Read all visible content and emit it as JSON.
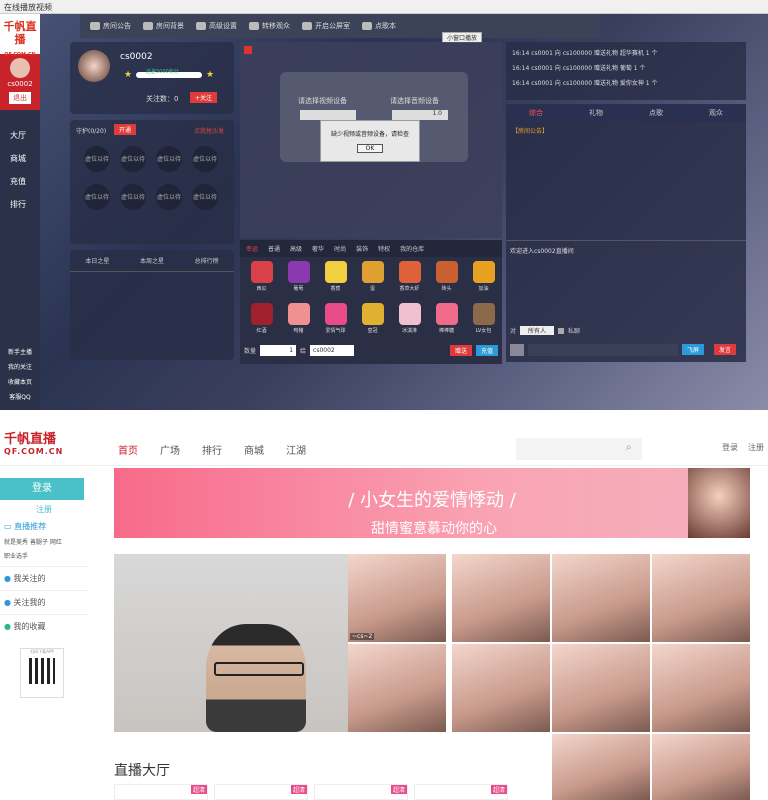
{
  "shot1": {
    "title": "在线播放视频",
    "topbar": [
      "房间公告",
      "房间背景",
      "高级设置",
      "转移观众",
      "开启公屏室",
      "点歌本"
    ],
    "popout": "小窗口播放",
    "logo": "千帆直播",
    "logo_sub": "QF.COM.CN",
    "side_user": "cs0002",
    "exit": "退出",
    "nav": [
      "大厅",
      "商城",
      "充值",
      "排行"
    ],
    "bottom_nav": [
      "新手主播",
      "我的关注",
      "收藏本页",
      "客服QQ"
    ],
    "user": {
      "name": "cs0002",
      "progress": "还差5000积分",
      "fans_label": "关注数：0",
      "follow": "+关注"
    },
    "guard": {
      "title": "守护(0/20)",
      "btn": "开通",
      "link": "点我抢沙发",
      "seat": "虚位以待"
    },
    "rank_tabs": [
      "本日之星",
      "本周之星",
      "总排行榜"
    ],
    "stage": {
      "video_label": "请选择视频设备",
      "audio_label": "请选择音频设备",
      "audio_value": "1.0",
      "dialog": "缺少视频或音频设备，请检查",
      "ok": "OK"
    },
    "gift_tabs": [
      "幸运",
      "普通",
      "高级",
      "奢华",
      "时尚",
      "装饰",
      "特权",
      "我的仓库"
    ],
    "gifts": [
      {
        "name": "西瓜",
        "color": "#d8404a"
      },
      {
        "name": "葡萄",
        "color": "#8a3ab0"
      },
      {
        "name": "香蕉",
        "color": "#f0d040"
      },
      {
        "name": "蛋",
        "color": "#e0a030"
      },
      {
        "name": "香草大虾",
        "color": "#e0603a"
      },
      {
        "name": "砖头",
        "color": "#c86030"
      },
      {
        "name": "加油",
        "color": "#e8a020"
      },
      {
        "name": "红酒",
        "color": "#a02030"
      },
      {
        "name": "吻猪",
        "color": "#f09090"
      },
      {
        "name": "爱情气球",
        "color": "#e84a8a"
      },
      {
        "name": "皇冠",
        "color": "#e0b030"
      },
      {
        "name": "冰淇淋",
        "color": "#f0c0d0"
      },
      {
        "name": "棒棒糖",
        "color": "#f06a8a"
      },
      {
        "name": "LV女包",
        "color": "#8a6a4a"
      }
    ],
    "gift_bottom": {
      "qty_label": "数量",
      "qty": "1",
      "to": "给",
      "target": "cs0002",
      "send": "赠送",
      "recharge": "充值"
    },
    "chat_lines": [
      "16:14 cs0001 向 cs100000 赠送礼物 超华赛机 1 个",
      "16:14 cs0001 向 cs100000 赠送礼物 葡萄 1 个",
      "16:14 cs0001 向 cs100000 赠送礼物 爱你女神 1 个"
    ],
    "right_tabs": [
      "综合",
      "礼物",
      "点歌",
      "观众"
    ],
    "notice": "【房间公告】",
    "welcome": "欢迎进入cs0002直播间",
    "chat_to": "对",
    "chat_target": "所有人",
    "private": "私聊",
    "fly": "飞屏",
    "send": "发言"
  },
  "shot2": {
    "logo": "千帆直播",
    "logo_sub": "QF.COM.CN",
    "nav": [
      "首页",
      "广场",
      "排行",
      "商城",
      "江湖"
    ],
    "login_top": "登录",
    "register_top": "注册",
    "login_btn": "登录",
    "register": "注册",
    "side_title": "直播推荐",
    "side_tags": [
      "就是美秀",
      "善腿子",
      "网红",
      "职业选手"
    ],
    "side_links": [
      "我关注的",
      "关注我的",
      "我的收藏"
    ],
    "qr_label": "扫码下载APP",
    "banner": "小女生的爱情悸动",
    "banner_sub": "甜情蜜意慕动你的心",
    "thumb_label": "~cs~2",
    "live_hall": "直播大厅",
    "tag": "超清"
  }
}
